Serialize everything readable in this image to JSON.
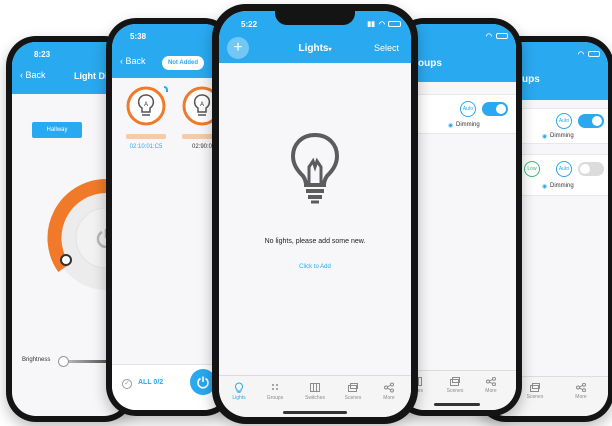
{
  "phone1": {
    "time": "8:23",
    "back_label": "Back",
    "title": "Light Di",
    "room_button": "Hallway",
    "brightness_label": "Brightness"
  },
  "phone2": {
    "time": "5:38",
    "back_label": "Back",
    "filter_label": "Not Added",
    "devices": [
      {
        "name": "02:10:01:C5"
      },
      {
        "name": "02:90:0"
      }
    ],
    "footer_label": "ALL 0/2"
  },
  "phone3": {
    "time": "5:22",
    "title": "Lights",
    "select_label": "Select",
    "empty_message": "No lights, please add some new.",
    "add_link": "Click to Add",
    "tabs": [
      {
        "label": "Lights",
        "icon": "bulb-icon"
      },
      {
        "label": "Groups",
        "icon": "groups-icon"
      },
      {
        "label": "Switches",
        "icon": "switches-icon"
      },
      {
        "label": "Scenes",
        "icon": "scenes-icon"
      },
      {
        "label": "More",
        "icon": "share-icon"
      }
    ]
  },
  "phone4": {
    "title": "oups",
    "auto_label": "Auto",
    "dimming_label": "Dimming",
    "tabs": [
      {
        "label": "tches"
      },
      {
        "label": "Scenes"
      },
      {
        "label": "More"
      }
    ]
  },
  "phone5": {
    "title": "ups",
    "auto_label": "Auto",
    "dimming_label": "Dimming",
    "low_label": "Low",
    "auto_label2": "Auto",
    "stage_label": "age",
    "dimming_label2": "Dimming",
    "tabs": [
      {
        "label": "les"
      },
      {
        "label": "Scenes"
      },
      {
        "label": "More"
      }
    ]
  },
  "colors": {
    "accent": "#29a9f0",
    "orange": "#f07a2a",
    "green": "#3cb878",
    "bezel": "#141414"
  }
}
